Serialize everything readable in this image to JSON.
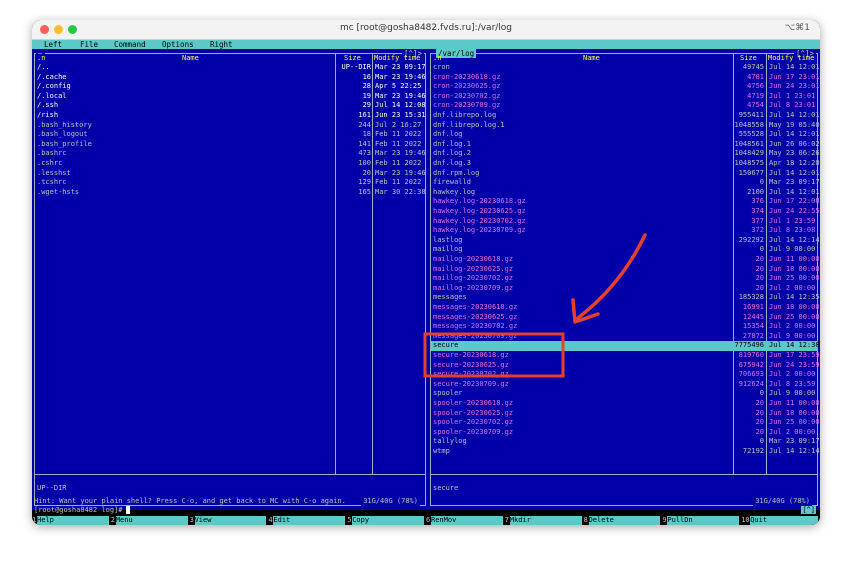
{
  "window": {
    "title": "mc [root@gosha8482.fvds.ru]:/var/log",
    "shortcut": "⌥⌘1"
  },
  "menu": [
    "Left",
    "File",
    "Command",
    "Options",
    "Right"
  ],
  "left_panel": {
    "title": "~",
    "corner": "[^]>",
    "headers": {
      "n": ".n",
      "name": "Name",
      "size": "Size",
      "mtime": "Modify time"
    },
    "rows": [
      {
        "name": "/..",
        "size": "UP--DIR",
        "time": "Mar 23 09:17",
        "kind": "dir"
      },
      {
        "name": "/.cache",
        "size": "16",
        "time": "Mar 23 19:46",
        "kind": "dir"
      },
      {
        "name": "/.config",
        "size": "28",
        "time": "Apr  5 22:25",
        "kind": "dir"
      },
      {
        "name": "/.local",
        "size": "19",
        "time": "Mar 23 19:46",
        "kind": "dir"
      },
      {
        "name": "/.ssh",
        "size": "29",
        "time": "Jul 14 12:08",
        "kind": "dir"
      },
      {
        "name": "/rish",
        "size": "161",
        "time": "Jun 23 15:31",
        "kind": "dir"
      },
      {
        "name": " .bash_history",
        "size": "244",
        "time": "Jul  2 16:27",
        "kind": "file"
      },
      {
        "name": " .bash_logout",
        "size": "18",
        "time": "Feb 11  2022",
        "kind": "file"
      },
      {
        "name": " .bash_profile",
        "size": "141",
        "time": "Feb 11  2022",
        "kind": "file"
      },
      {
        "name": " .bashrc",
        "size": "473",
        "time": "Mar 23 19:46",
        "kind": "file"
      },
      {
        "name": " .cshrc",
        "size": "100",
        "time": "Feb 11  2022",
        "kind": "file"
      },
      {
        "name": " .lesshst",
        "size": "20",
        "time": "Mar 23 19:46",
        "kind": "file"
      },
      {
        "name": " .tcshrc",
        "size": "129",
        "time": "Feb 11  2022",
        "kind": "file"
      },
      {
        "name": " .wget-hsts",
        "size": "165",
        "time": "Mar 30 22:38",
        "kind": "file"
      }
    ],
    "status": "UP--DIR",
    "free": "31G/40G (78%)"
  },
  "right_panel": {
    "title": "/var/log",
    "corner": "[^]>",
    "headers": {
      "n": ".n",
      "name": "Name",
      "size": "Size",
      "mtime": "Modify time"
    },
    "rows": [
      {
        "name": " cron",
        "size": "49745",
        "time": "Jul 14 12:01",
        "kind": "file"
      },
      {
        "name": " cron-20230618.gz",
        "size": "4781",
        "time": "Jun 17 23:01",
        "kind": "arch"
      },
      {
        "name": " cron-20230625.gz",
        "size": "4756",
        "time": "Jun 24 23:01",
        "kind": "arch"
      },
      {
        "name": " cron-20230702.gz",
        "size": "4719",
        "time": "Jul  1 23:01",
        "kind": "arch"
      },
      {
        "name": " cron-20230709.gz",
        "size": "4754",
        "time": "Jul  8 23:01",
        "kind": "arch"
      },
      {
        "name": " dnf.librepo.log",
        "size": "955411",
        "time": "Jul 14 12:01",
        "kind": "file"
      },
      {
        "name": " dnf.librepo.log.1",
        "size": "1048558",
        "time": "May 19 05:40",
        "kind": "file"
      },
      {
        "name": " dnf.log",
        "size": "555528",
        "time": "Jul 14 12:01",
        "kind": "file"
      },
      {
        "name": " dnf.log.1",
        "size": "1048561",
        "time": "Jun 26 06:02",
        "kind": "file"
      },
      {
        "name": " dnf.log.2",
        "size": "1048429",
        "time": "May 23 06:26",
        "kind": "file"
      },
      {
        "name": " dnf.log.3",
        "size": "1048575",
        "time": "Apr 18 12:20",
        "kind": "file"
      },
      {
        "name": " dnf.rpm.log",
        "size": "150677",
        "time": "Jul 14 12:01",
        "kind": "file"
      },
      {
        "name": " firewalld",
        "size": "0",
        "time": "Mar 23 09:17",
        "kind": "file"
      },
      {
        "name": " hawkey.log",
        "size": "2100",
        "time": "Jul 14 12:01",
        "kind": "file"
      },
      {
        "name": " hawkey.log-20230618.gz",
        "size": "376",
        "time": "Jun 17 22:08",
        "kind": "arch"
      },
      {
        "name": " hawkey.log-20230625.gz",
        "size": "374",
        "time": "Jun 24 22:55",
        "kind": "arch"
      },
      {
        "name": " hawkey.log-20230702.gz",
        "size": "377",
        "time": "Jul  1 23:59",
        "kind": "arch"
      },
      {
        "name": " hawkey.log-20230709.gz",
        "size": "372",
        "time": "Jul  8 23:08",
        "kind": "arch"
      },
      {
        "name": " lastlog",
        "size": "292292",
        "time": "Jul 14 12:14",
        "kind": "file"
      },
      {
        "name": " maillog",
        "size": "0",
        "time": "Jul  9 00:00",
        "kind": "file"
      },
      {
        "name": " maillog-20230618.gz",
        "size": "20",
        "time": "Jun 11 00:00",
        "kind": "arch"
      },
      {
        "name": " maillog-20230625.gz",
        "size": "20",
        "time": "Jun 18 00:00",
        "kind": "arch"
      },
      {
        "name": " maillog-20230702.gz",
        "size": "20",
        "time": "Jun 25 00:00",
        "kind": "arch"
      },
      {
        "name": " maillog-20230709.gz",
        "size": "20",
        "time": "Jul  2 00:00",
        "kind": "arch"
      },
      {
        "name": " messages",
        "size": "185328",
        "time": "Jul 14 12:35",
        "kind": "file"
      },
      {
        "name": " messages-20230618.gz",
        "size": "16991",
        "time": "Jun 18 00:00",
        "kind": "arch"
      },
      {
        "name": " messages-20230625.gz",
        "size": "12445",
        "time": "Jun 25 00:00",
        "kind": "arch"
      },
      {
        "name": " messages-20230702.gz",
        "size": "15354",
        "time": "Jul  2 00:00",
        "kind": "arch"
      },
      {
        "name": " messages-20230709.gz",
        "size": "27872",
        "time": "Jul  9 00:00",
        "kind": "arch"
      },
      {
        "name": " secure",
        "size": "7775496",
        "time": "Jul 14 12:38",
        "kind": "file",
        "selected": true
      },
      {
        "name": " secure-20230618.gz",
        "size": "819760",
        "time": "Jun 17 23:59",
        "kind": "arch"
      },
      {
        "name": " secure-20230625.gz",
        "size": "675942",
        "time": "Jun 24 23:59",
        "kind": "arch"
      },
      {
        "name": " secure-20230702.gz",
        "size": "706693",
        "time": "Jul  2 00:00",
        "kind": "arch"
      },
      {
        "name": " secure-20230709.gz",
        "size": "912624",
        "time": "Jul  8 23:59",
        "kind": "arch"
      },
      {
        "name": " spooler",
        "size": "0",
        "time": "Jul  9 00:00",
        "kind": "file"
      },
      {
        "name": " spooler-20230618.gz",
        "size": "20",
        "time": "Jun 11 00:00",
        "kind": "arch"
      },
      {
        "name": " spooler-20230625.gz",
        "size": "20",
        "time": "Jun 18 00:00",
        "kind": "arch"
      },
      {
        "name": " spooler-20230702.gz",
        "size": "20",
        "time": "Jun 25 00:00",
        "kind": "arch"
      },
      {
        "name": " spooler-20230709.gz",
        "size": "20",
        "time": "Jul  2 00:00",
        "kind": "arch"
      },
      {
        "name": " tallylog",
        "size": "0",
        "time": "Mar 23 09:17",
        "kind": "file"
      },
      {
        "name": " wtmp",
        "size": "72192",
        "time": "Jul 14 12:14",
        "kind": "file"
      }
    ],
    "status": "secure",
    "free": "31G/40G (78%)"
  },
  "hint": "Hint: Want your plain shell? Press C-o, and get back to MC with C-o again.",
  "prompt": "[root@gosha8482 log]#",
  "prompt_corner": "[^]",
  "fkeys": [
    {
      "num": "1",
      "label": "Help"
    },
    {
      "num": "2",
      "label": "Menu"
    },
    {
      "num": "3",
      "label": "View"
    },
    {
      "num": "4",
      "label": "Edit"
    },
    {
      "num": "5",
      "label": "Copy"
    },
    {
      "num": "6",
      "label": "RenMov"
    },
    {
      "num": "7",
      "label": "Mkdir"
    },
    {
      "num": "8",
      "label": "Delete"
    },
    {
      "num": "9",
      "label": "PullDn"
    },
    {
      "num": "10",
      "label": "Quit"
    }
  ],
  "colors": {
    "panel_bg": "#0000a8",
    "cyan": "#5cc9c9",
    "dir_fg": "#ffffff",
    "file_fg": "#c0c0c0",
    "arch_fg": "#e070e0",
    "header_fg": "#ffff55",
    "annotation_red": "#e8402a"
  }
}
